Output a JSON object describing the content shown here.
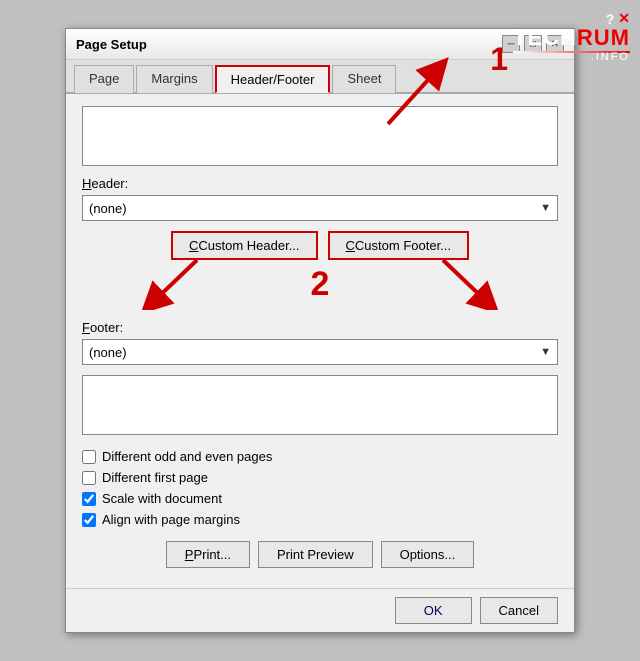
{
  "watermark": {
    "question": "?",
    "close": "✕",
    "tech": "TECH",
    "rum": "RUM",
    "info": ".INFO"
  },
  "dialog": {
    "title": "Page Setup",
    "tabs": [
      "Page",
      "Margins",
      "Header/Footer",
      "Sheet"
    ],
    "active_tab": "Header/Footer",
    "header_label": "Header:",
    "header_value": "(none)",
    "footer_label": "Footer:",
    "footer_value": "(none)",
    "custom_header_btn": "Custom Header...",
    "custom_footer_btn": "Custom Footer...",
    "checkboxes": [
      {
        "label": "Different odd and even pages",
        "checked": false
      },
      {
        "label": "Different first page",
        "checked": false
      },
      {
        "label": "Scale with document",
        "checked": true
      },
      {
        "label": "Align with page margins",
        "checked": true
      }
    ],
    "bottom_buttons": {
      "print": "Print...",
      "print_preview": "Print Preview",
      "options": "Options..."
    },
    "ok_label": "OK",
    "cancel_label": "Cancel"
  },
  "annotations": {
    "num1": "1",
    "num2": "2"
  }
}
